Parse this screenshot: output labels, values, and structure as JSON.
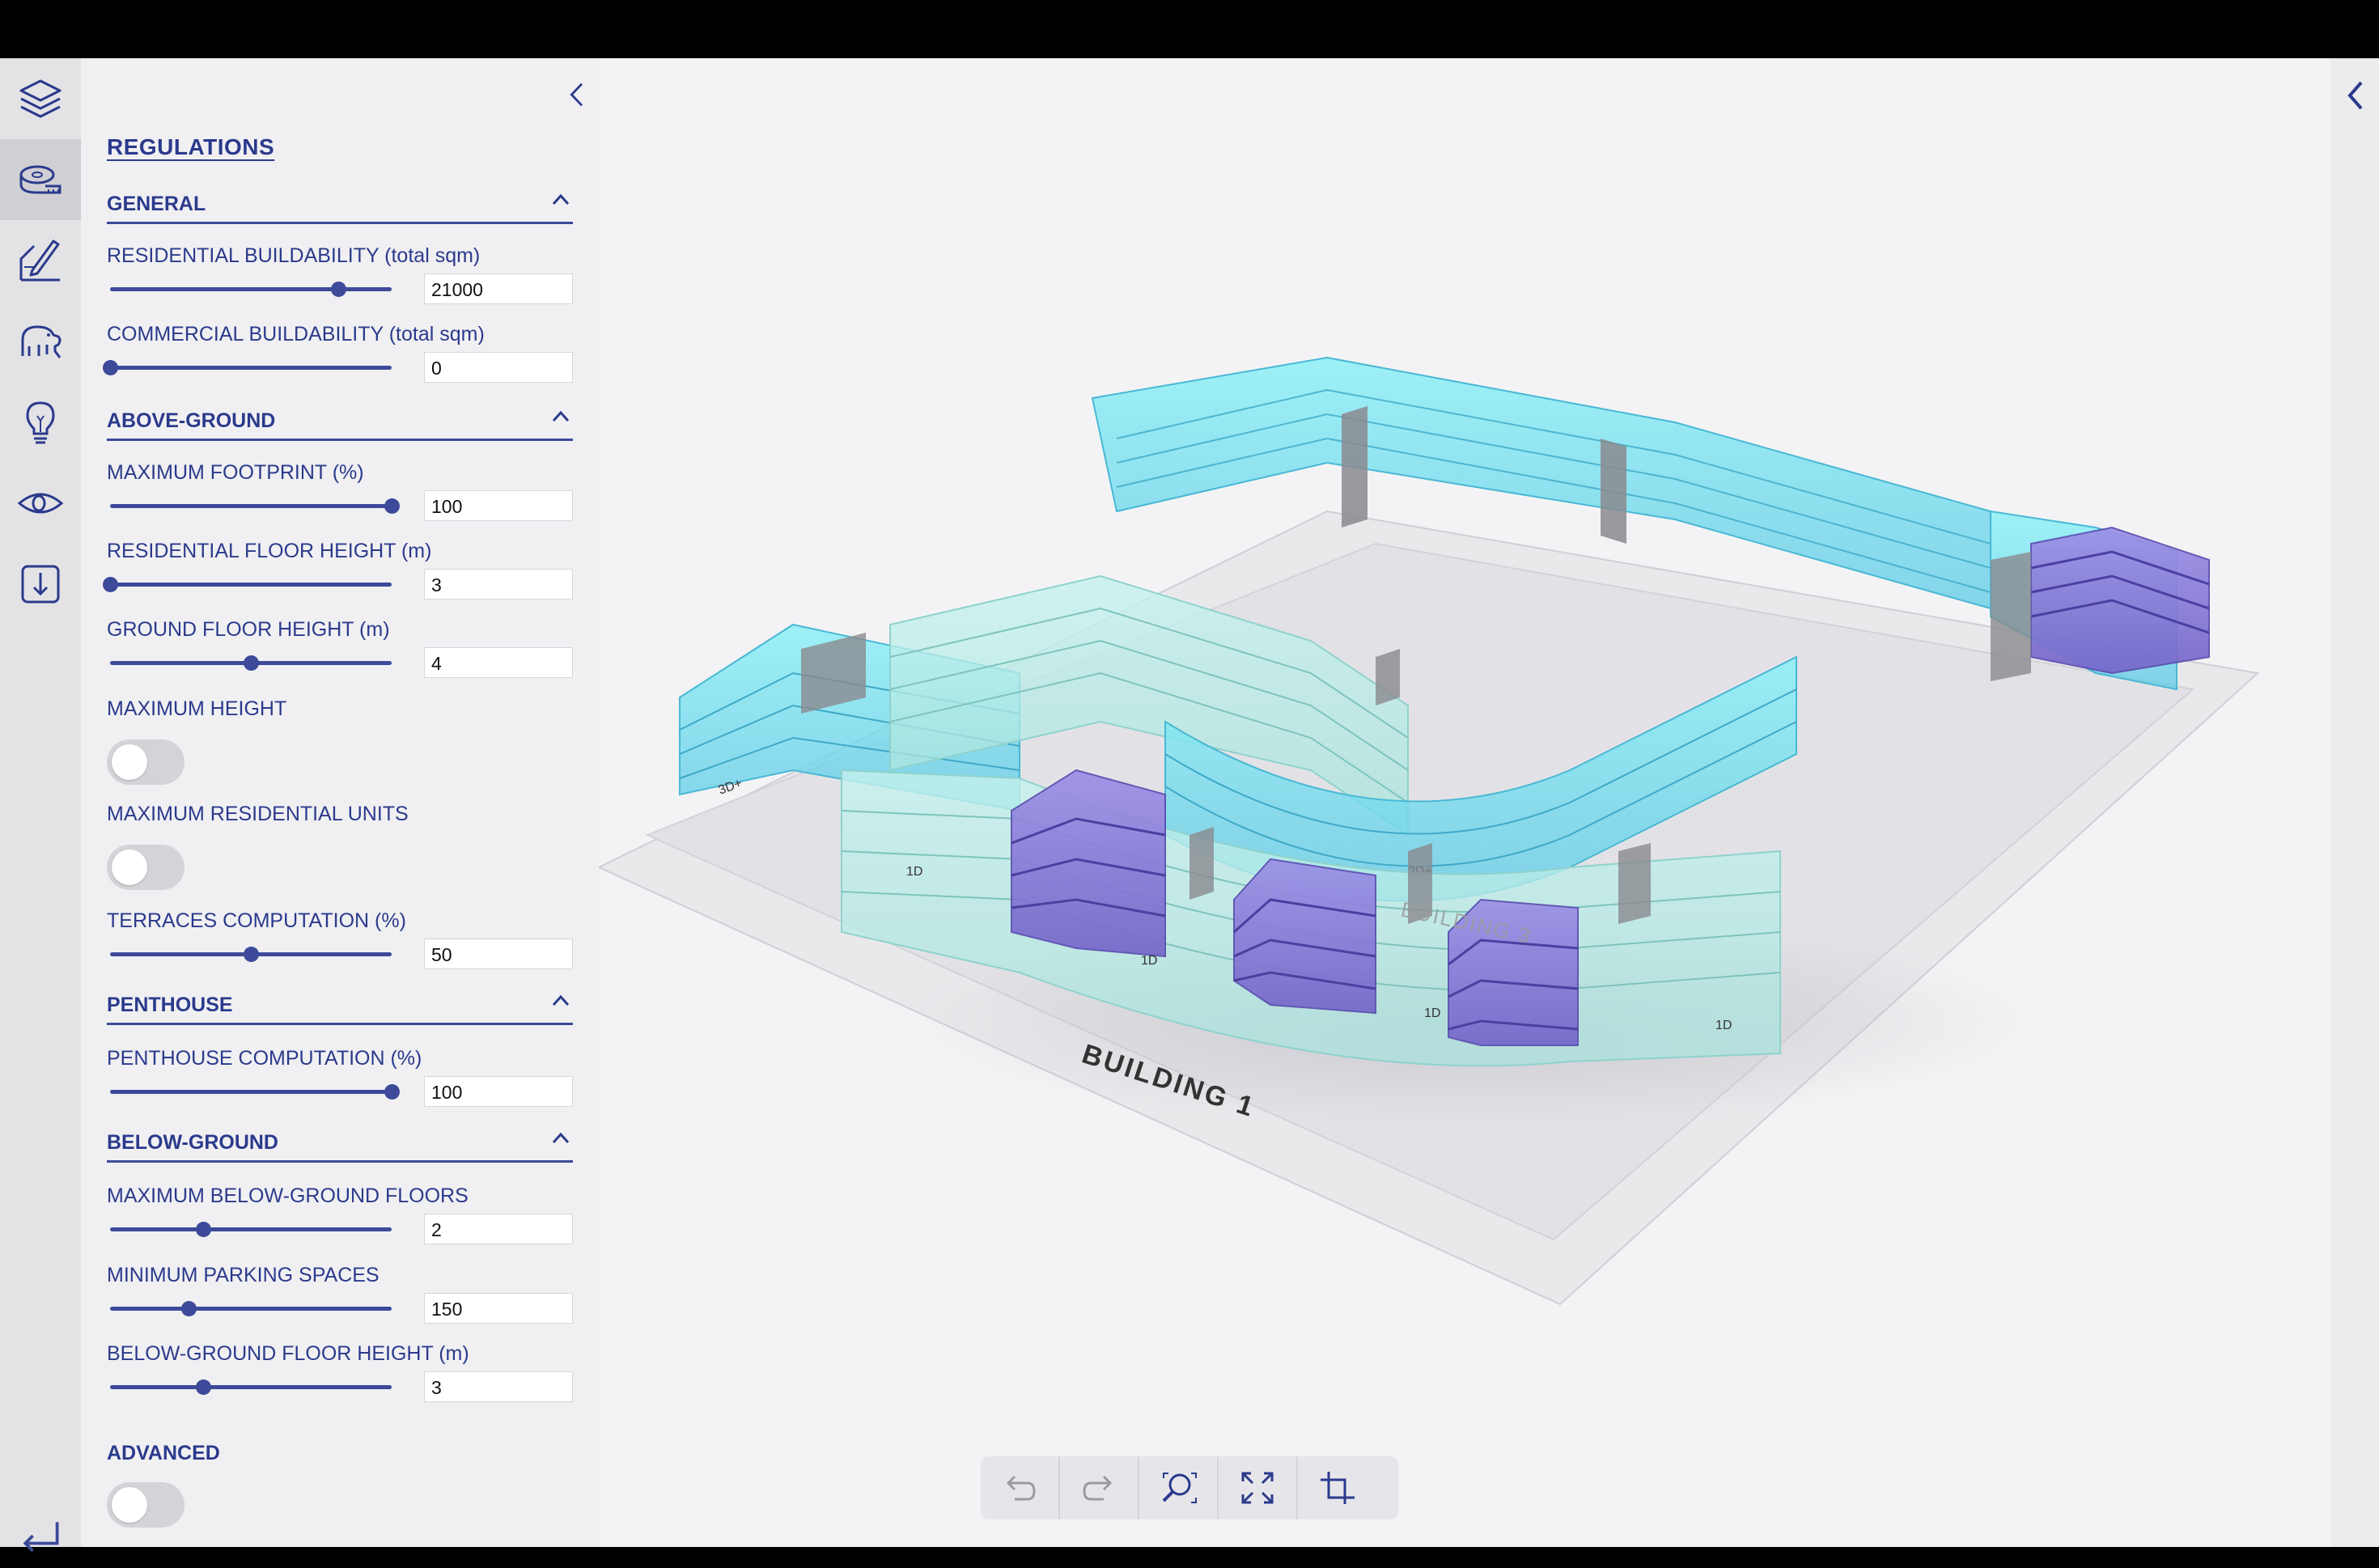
{
  "rail": {
    "items": [
      {
        "icon": "layers-icon",
        "active": false
      },
      {
        "icon": "measuring-tape-icon",
        "active": true
      },
      {
        "icon": "drawing-pen-icon",
        "active": false
      },
      {
        "icon": "elephant-icon",
        "active": false
      },
      {
        "icon": "lightbulb-icon",
        "active": false
      },
      {
        "icon": "eye-icon",
        "active": false
      },
      {
        "icon": "download-icon",
        "active": false
      }
    ],
    "exit_icon": "return-arrow-icon"
  },
  "panel": {
    "title": "REGULATIONS",
    "sections": {
      "general": "GENERAL",
      "above_ground": "ABOVE-GROUND",
      "penthouse": "PENTHOUSE",
      "below_ground": "BELOW-GROUND"
    },
    "fields": {
      "residential_buildability": {
        "label": "RESIDENTIAL BUILDABILITY (total sqm)",
        "value": "21000",
        "slider_fraction": 0.81
      },
      "commercial_buildability": {
        "label": "COMMERCIAL BUILDABILITY (total sqm)",
        "value": "0",
        "slider_fraction": 0.0
      },
      "maximum_footprint": {
        "label": "MAXIMUM FOOTPRINT (%)",
        "value": "100",
        "slider_fraction": 1.0
      },
      "residential_floor_height": {
        "label": "RESIDENTIAL FLOOR HEIGHT (m)",
        "value": "3",
        "slider_fraction": 0.0
      },
      "ground_floor_height": {
        "label": "GROUND FLOOR HEIGHT (m)",
        "value": "4",
        "slider_fraction": 0.5
      },
      "terraces_computation": {
        "label": "TERRACES COMPUTATION (%)",
        "value": "50",
        "slider_fraction": 0.5
      },
      "penthouse_computation": {
        "label": "PENTHOUSE COMPUTATION (%)",
        "value": "100",
        "slider_fraction": 1.0
      },
      "max_below_ground_floors": {
        "label": "MAXIMUM BELOW-GROUND FLOORS",
        "value": "2",
        "slider_fraction": 0.33
      },
      "minimum_parking_spaces": {
        "label": "MINIMUM PARKING SPACES",
        "value": "150",
        "slider_fraction": 0.28
      },
      "below_ground_floor_height": {
        "label": "BELOW-GROUND FLOOR HEIGHT (m)",
        "value": "3",
        "slider_fraction": 0.33
      }
    },
    "toggles": {
      "maximum_height": {
        "label": "MAXIMUM HEIGHT",
        "on": false
      },
      "maximum_residential_units": {
        "label": "MAXIMUM RESIDENTIAL UNITS",
        "on": false
      },
      "advanced": {
        "label": "ADVANCED",
        "on": false
      }
    }
  },
  "viewport": {
    "labels": {
      "building_1": "BUILDING 1",
      "building_3": "BUILDING 3"
    },
    "colors": {
      "cyan": "#7fe3ee",
      "purple": "#8f83d8",
      "grey": "#8a8a8e"
    }
  },
  "toolbar": {
    "items": [
      "undo-icon",
      "redo-icon",
      "zoom-fit-icon",
      "expand-icon",
      "crop-icon"
    ]
  }
}
